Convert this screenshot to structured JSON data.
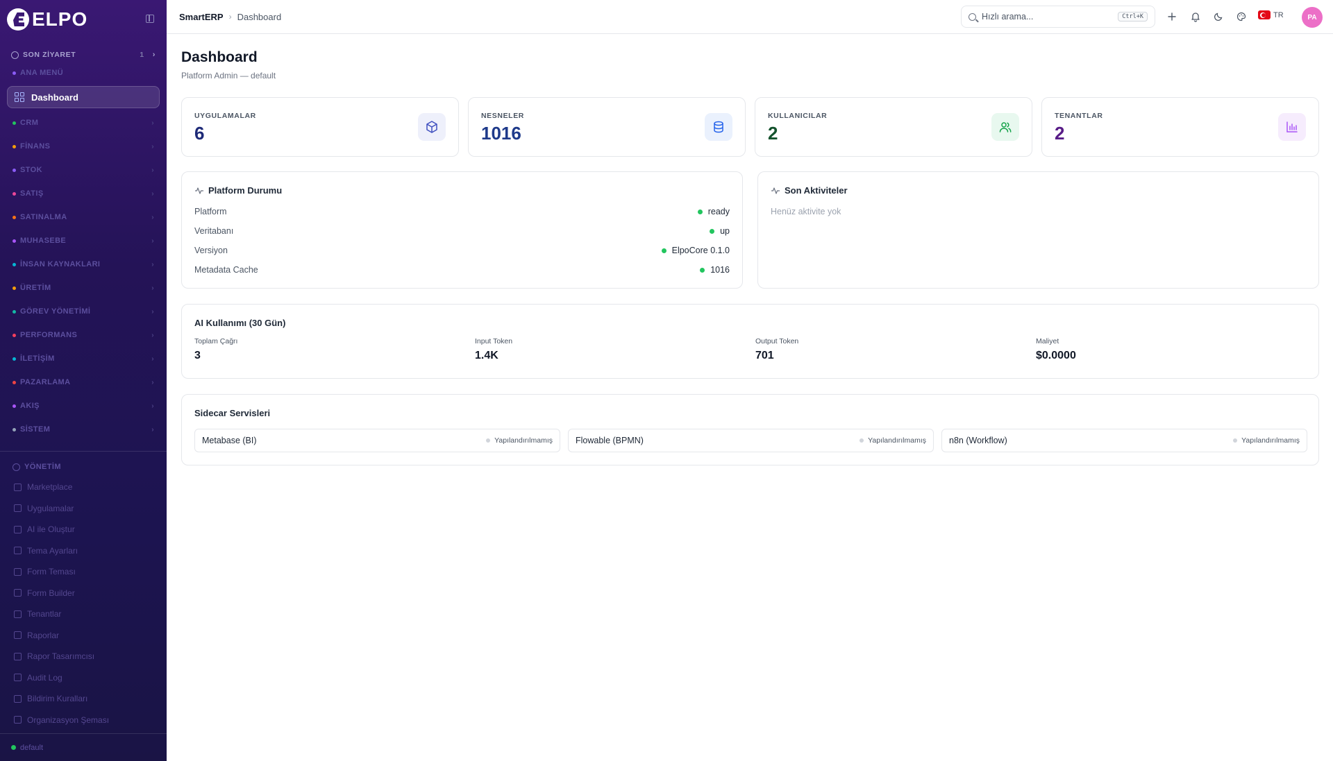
{
  "sidebar": {
    "brand": "ELPO",
    "recent": {
      "label": "SON ZİYARET",
      "count": "1"
    },
    "main_menu_label": "ANA MENÜ",
    "active_item": "Dashboard",
    "groups": [
      {
        "label": "CRM",
        "color": "#22c55e"
      },
      {
        "label": "FİNANS",
        "color": "#f59e0b"
      },
      {
        "label": "STOK",
        "color": "#8b5cf6"
      },
      {
        "label": "SATIŞ",
        "color": "#ec4899"
      },
      {
        "label": "SATINALMA",
        "color": "#f97316"
      },
      {
        "label": "MUHASEBE",
        "color": "#a855f7"
      },
      {
        "label": "İNSAN KAYNAKLARI",
        "color": "#06b6d4"
      },
      {
        "label": "ÜRETİM",
        "color": "#f59e0b"
      },
      {
        "label": "GÖREV YÖNETİMİ",
        "color": "#14b8a6"
      },
      {
        "label": "PERFORMANS",
        "color": "#f43f5e"
      },
      {
        "label": "İLETİŞİM",
        "color": "#06b6d4"
      },
      {
        "label": "PAZARLAMA",
        "color": "#ef4444"
      },
      {
        "label": "AKIŞ",
        "color": "#a855f7"
      },
      {
        "label": "SİSTEM",
        "color": "#94a3b8"
      }
    ],
    "admin": {
      "label": "YÖNETİM",
      "items": [
        "Marketplace",
        "Uygulamalar",
        "AI ile Oluştur",
        "Tema Ayarları",
        "Form Teması",
        "Form Builder",
        "Tenantlar",
        "Raporlar",
        "Rapor Tasarımcısı",
        "Audit Log",
        "Bildirim Kuralları",
        "Organizasyon Şeması"
      ]
    },
    "footer": "default"
  },
  "topbar": {
    "app": "SmartERP",
    "page": "Dashboard",
    "search_placeholder": "Hızlı arama...",
    "shortcut": "Ctrl+K",
    "lang": "TR",
    "avatar": "PA"
  },
  "page": {
    "title": "Dashboard",
    "subtitle": "Platform Admin — default"
  },
  "stats": [
    {
      "label": "UYGULAMALAR",
      "value": "6",
      "color": "#1e2a78",
      "icon_bg": "#eef0fb",
      "icon_color": "#3f4fbf",
      "icon": "cube-icon"
    },
    {
      "label": "NESNELER",
      "value": "1016",
      "color": "#1e3a8a",
      "icon_bg": "#eaf1fd",
      "icon_color": "#2563eb",
      "icon": "database-icon"
    },
    {
      "label": "KULLANICILAR",
      "value": "2",
      "color": "#14532d",
      "icon_bg": "#e8f8ef",
      "icon_color": "#16a34a",
      "icon": "users-icon"
    },
    {
      "label": "TENANTLAR",
      "value": "2",
      "color": "#581c87",
      "icon_bg": "#f6ecfd",
      "icon_color": "#a855f7",
      "icon": "chart-icon"
    }
  ],
  "platform_status": {
    "title": "Platform Durumu",
    "rows": [
      {
        "label": "Platform",
        "value": "ready"
      },
      {
        "label": "Veritabanı",
        "value": "up"
      },
      {
        "label": "Versiyon",
        "value": "ElpoCore 0.1.0"
      },
      {
        "label": "Metadata Cache",
        "value": "1016"
      }
    ]
  },
  "activities": {
    "title": "Son Aktiviteler",
    "empty": "Henüz aktivite yok"
  },
  "ai_usage": {
    "title": "AI Kullanımı (30 Gün)",
    "metrics": [
      {
        "label": "Toplam Çağrı",
        "value": "3"
      },
      {
        "label": "Input Token",
        "value": "1.4K"
      },
      {
        "label": "Output Token",
        "value": "701"
      },
      {
        "label": "Maliyet",
        "value": "$0.0000"
      }
    ]
  },
  "sidecar": {
    "title": "Sidecar Servisleri",
    "services": [
      {
        "name": "Metabase (BI)",
        "status": "Yapılandırılmamış"
      },
      {
        "name": "Flowable (BPMN)",
        "status": "Yapılandırılmamış"
      },
      {
        "name": "n8n (Workflow)",
        "status": "Yapılandırılmamış"
      }
    ]
  }
}
